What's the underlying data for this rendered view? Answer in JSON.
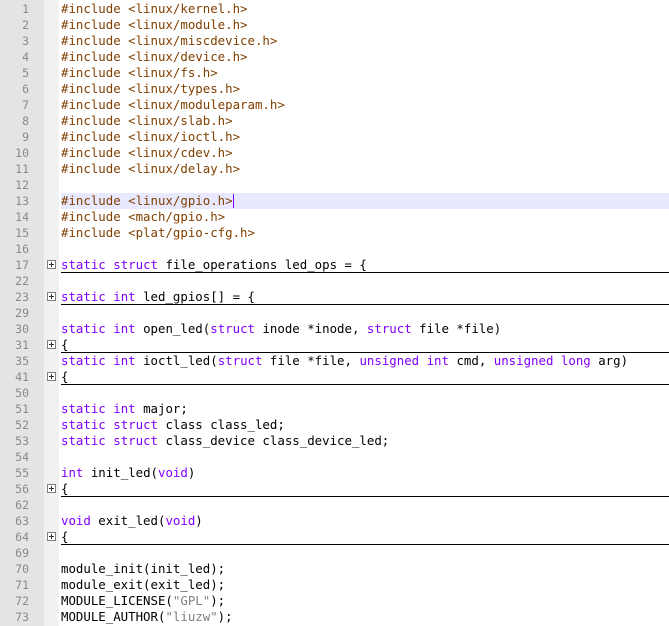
{
  "editor": {
    "theme": {
      "gutter_bg": "#e4e4e4",
      "fold_margin_bg": "#f1f1f1",
      "current_line_bg": "#e8e8ff",
      "preprocessor_color": "#804000",
      "keyword_color": "#8000ff",
      "string_color": "#808080"
    },
    "lines": [
      {
        "num": "1",
        "tokens": [
          {
            "t": "#include <linux/kernel.h>",
            "c": "inc"
          }
        ]
      },
      {
        "num": "2",
        "tokens": [
          {
            "t": "#include <linux/module.h>",
            "c": "inc"
          }
        ]
      },
      {
        "num": "3",
        "tokens": [
          {
            "t": "#include <linux/miscdevice.h>",
            "c": "inc"
          }
        ]
      },
      {
        "num": "4",
        "tokens": [
          {
            "t": "#include <linux/device.h>",
            "c": "inc"
          }
        ]
      },
      {
        "num": "5",
        "tokens": [
          {
            "t": "#include <linux/fs.h>",
            "c": "inc"
          }
        ]
      },
      {
        "num": "6",
        "tokens": [
          {
            "t": "#include <linux/types.h>",
            "c": "inc"
          }
        ]
      },
      {
        "num": "7",
        "tokens": [
          {
            "t": "#include <linux/moduleparam.h>",
            "c": "inc"
          }
        ]
      },
      {
        "num": "8",
        "tokens": [
          {
            "t": "#include <linux/slab.h>",
            "c": "inc"
          }
        ]
      },
      {
        "num": "9",
        "tokens": [
          {
            "t": "#include <linux/ioctl.h>",
            "c": "inc"
          }
        ]
      },
      {
        "num": "10",
        "tokens": [
          {
            "t": "#include <linux/cdev.h>",
            "c": "inc"
          }
        ]
      },
      {
        "num": "11",
        "tokens": [
          {
            "t": "#include <linux/delay.h>",
            "c": "inc"
          }
        ]
      },
      {
        "num": "12",
        "tokens": []
      },
      {
        "num": "13",
        "current": true,
        "tokens": [
          {
            "t": "#include <linux/gpio.h>",
            "c": "inc"
          },
          {
            "t": "",
            "c": "cursor"
          }
        ]
      },
      {
        "num": "14",
        "tokens": [
          {
            "t": "#include <mach/gpio.h>",
            "c": "inc"
          }
        ]
      },
      {
        "num": "15",
        "tokens": [
          {
            "t": "#include <plat/gpio-cfg.h>",
            "c": "inc"
          }
        ]
      },
      {
        "num": "16",
        "tokens": []
      },
      {
        "num": "17",
        "fold": true,
        "folded": true,
        "tokens": [
          {
            "t": "static",
            "c": "kw"
          },
          {
            "t": " ",
            "c": "plain"
          },
          {
            "t": "struct",
            "c": "kw"
          },
          {
            "t": " file_operations led_ops = {",
            "c": "plain"
          }
        ]
      },
      {
        "num": "22",
        "tokens": []
      },
      {
        "num": "23",
        "fold": true,
        "folded": true,
        "tokens": [
          {
            "t": "static",
            "c": "kw"
          },
          {
            "t": " ",
            "c": "plain"
          },
          {
            "t": "int",
            "c": "kw"
          },
          {
            "t": " led_gpios[] = {",
            "c": "plain"
          }
        ]
      },
      {
        "num": "29",
        "tokens": []
      },
      {
        "num": "30",
        "tokens": [
          {
            "t": "static",
            "c": "kw"
          },
          {
            "t": " ",
            "c": "plain"
          },
          {
            "t": "int",
            "c": "kw"
          },
          {
            "t": " open_led(",
            "c": "plain"
          },
          {
            "t": "struct",
            "c": "kw"
          },
          {
            "t": " inode *inode, ",
            "c": "plain"
          },
          {
            "t": "struct",
            "c": "kw"
          },
          {
            "t": " file *file)",
            "c": "plain"
          }
        ]
      },
      {
        "num": "31",
        "fold": true,
        "folded": true,
        "tokens": [
          {
            "t": "{",
            "c": "plain"
          }
        ]
      },
      {
        "num": "35",
        "tokens": [
          {
            "t": "static",
            "c": "kw"
          },
          {
            "t": " ",
            "c": "plain"
          },
          {
            "t": "int",
            "c": "kw"
          },
          {
            "t": " ioctl_led(",
            "c": "plain"
          },
          {
            "t": "struct",
            "c": "kw"
          },
          {
            "t": " file *file, ",
            "c": "plain"
          },
          {
            "t": "unsigned",
            "c": "kw"
          },
          {
            "t": " ",
            "c": "plain"
          },
          {
            "t": "int",
            "c": "kw"
          },
          {
            "t": " cmd, ",
            "c": "plain"
          },
          {
            "t": "unsigned",
            "c": "kw"
          },
          {
            "t": " ",
            "c": "plain"
          },
          {
            "t": "long",
            "c": "kw"
          },
          {
            "t": " arg)",
            "c": "plain"
          }
        ]
      },
      {
        "num": "41",
        "fold": true,
        "folded": true,
        "tokens": [
          {
            "t": "{",
            "c": "plain"
          }
        ]
      },
      {
        "num": "50",
        "tokens": []
      },
      {
        "num": "51",
        "tokens": [
          {
            "t": "static",
            "c": "kw"
          },
          {
            "t": " ",
            "c": "plain"
          },
          {
            "t": "int",
            "c": "kw"
          },
          {
            "t": " major;",
            "c": "plain"
          }
        ]
      },
      {
        "num": "52",
        "tokens": [
          {
            "t": "static",
            "c": "kw"
          },
          {
            "t": " ",
            "c": "plain"
          },
          {
            "t": "struct",
            "c": "kw"
          },
          {
            "t": " class class_led;",
            "c": "plain"
          }
        ]
      },
      {
        "num": "53",
        "tokens": [
          {
            "t": "static",
            "c": "kw"
          },
          {
            "t": " ",
            "c": "plain"
          },
          {
            "t": "struct",
            "c": "kw"
          },
          {
            "t": " class_device class_device_led;",
            "c": "plain"
          }
        ]
      },
      {
        "num": "54",
        "tokens": []
      },
      {
        "num": "55",
        "tokens": [
          {
            "t": "int",
            "c": "kw"
          },
          {
            "t": " init_led(",
            "c": "plain"
          },
          {
            "t": "void",
            "c": "kw"
          },
          {
            "t": ")",
            "c": "plain"
          }
        ]
      },
      {
        "num": "56",
        "fold": true,
        "folded": true,
        "tokens": [
          {
            "t": "{",
            "c": "plain"
          }
        ]
      },
      {
        "num": "62",
        "tokens": []
      },
      {
        "num": "63",
        "tokens": [
          {
            "t": "void",
            "c": "kw"
          },
          {
            "t": " exit_led(",
            "c": "plain"
          },
          {
            "t": "void",
            "c": "kw"
          },
          {
            "t": ")",
            "c": "plain"
          }
        ]
      },
      {
        "num": "64",
        "fold": true,
        "folded": true,
        "tokens": [
          {
            "t": "{",
            "c": "plain"
          }
        ]
      },
      {
        "num": "69",
        "tokens": []
      },
      {
        "num": "70",
        "tokens": [
          {
            "t": "module_init(init_led);",
            "c": "plain"
          }
        ]
      },
      {
        "num": "71",
        "tokens": [
          {
            "t": "module_exit(exit_led);",
            "c": "plain"
          }
        ]
      },
      {
        "num": "72",
        "tokens": [
          {
            "t": "MODULE_LICENSE(",
            "c": "plain"
          },
          {
            "t": "\"GPL\"",
            "c": "str"
          },
          {
            "t": ");",
            "c": "plain"
          }
        ]
      },
      {
        "num": "73",
        "tokens": [
          {
            "t": "MODULE_AUTHOR(",
            "c": "plain"
          },
          {
            "t": "\"liuzw\"",
            "c": "str"
          },
          {
            "t": ");",
            "c": "plain"
          }
        ]
      }
    ]
  }
}
